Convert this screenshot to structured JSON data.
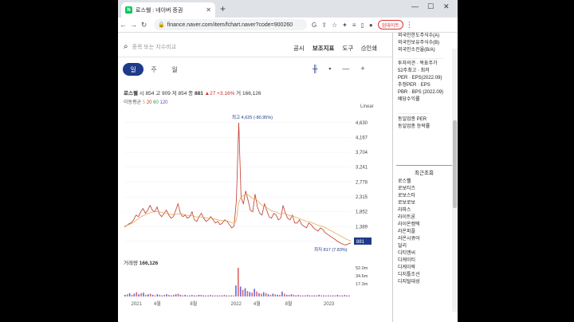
{
  "browser": {
    "tab_title": "로스웰 : 네이버 증권",
    "favicon": "N",
    "new_tab": "+",
    "url": "finance.naver.com/item/fchart.naver?code=900260",
    "update_label": "업데이트"
  },
  "toolbar": {
    "search_placeholder": "종목 또는 지수비교",
    "notice": "공시",
    "indicators": "보조지표",
    "tools": "도구",
    "print": "인쇄"
  },
  "range_tabs": [
    "일",
    "주",
    "월"
  ],
  "price": {
    "name": "로스웰",
    "open_label": "시",
    "open": "854",
    "high_label": "고",
    "high": "909",
    "low_label": "저",
    "low": "854",
    "close_label": "종",
    "close": "881",
    "change": "▲27",
    "pct": "+3.16%",
    "vol_label": "거",
    "volume": "166,126"
  },
  "ma": {
    "label": "이동평균",
    "p5": "5",
    "p20": "20",
    "p60": "60",
    "p120": "120"
  },
  "scale_label": "Linear",
  "price_labels": {
    "max": "최고 4,625 (-80.95%)",
    "min": "최저 817 (7.83%)",
    "last": "881"
  },
  "volume_panel": {
    "label": "거래량",
    "value": "166,126"
  },
  "chart_data": {
    "type": "line",
    "title": "",
    "xlabel": "",
    "ylabel": "",
    "y_ticks": [
      "4,630",
      "4,167",
      "3,704",
      "3,241",
      "2,778",
      "2,315",
      "1,852",
      "1,389",
      "926"
    ],
    "x_ticks": [
      "2021",
      "4월",
      "8월",
      "2022",
      "4월",
      "8월",
      "2023"
    ],
    "ylim": [
      800,
      4700
    ],
    "vol_ticks": [
      "52.0m",
      "34.6m",
      "17.3m"
    ],
    "series": [
      {
        "values": [
          1380,
          1420,
          1480,
          1510,
          1600,
          1750,
          1700,
          1850,
          1950,
          1800,
          1900,
          2050,
          1900,
          1850,
          2000,
          1780,
          1700,
          1800,
          1900,
          1750,
          1650,
          1700,
          1900,
          2100,
          1800,
          1700,
          1750,
          1650,
          1700,
          1850,
          1600,
          1550,
          1700,
          1800,
          1650,
          1550,
          1600,
          1700,
          1600,
          1500,
          1550,
          1450,
          1500,
          1600,
          1550,
          1450,
          1350,
          1400,
          2200,
          4625,
          2300,
          2100,
          2500,
          2200,
          1900,
          1850,
          2400,
          2000,
          1800,
          1750,
          2100,
          1900,
          1700,
          1650,
          1800,
          1750,
          1600,
          1650,
          2050,
          1800,
          1650,
          1600,
          1750,
          1500,
          1500,
          1600,
          1450,
          1400,
          1350,
          1500,
          1450,
          1350,
          1300,
          1250,
          1350,
          1300,
          1200,
          1150,
          1100,
          1050,
          1000,
          950,
          900,
          860,
          830,
          817,
          850,
          881
        ]
      },
      {
        "values": [
          1400,
          1420,
          1450,
          1480,
          1520,
          1580,
          1640,
          1690,
          1730,
          1760,
          1790,
          1820,
          1840,
          1850,
          1860,
          1850,
          1830,
          1810,
          1800,
          1790,
          1770,
          1760,
          1770,
          1790,
          1790,
          1780,
          1760,
          1740,
          1730,
          1730,
          1710,
          1690,
          1690,
          1690,
          1680,
          1660,
          1650,
          1650,
          1640,
          1620,
          1600,
          1580,
          1570,
          1570,
          1560,
          1540,
          1510,
          1490,
          1580,
          2150,
          2300,
          2350,
          2400,
          2380,
          2320,
          2260,
          2250,
          2200,
          2120,
          2050,
          2020,
          1980,
          1930,
          1880,
          1860,
          1840,
          1800,
          1780,
          1800,
          1790,
          1760,
          1730,
          1720,
          1690,
          1660,
          1640,
          1610,
          1580,
          1550,
          1540,
          1520,
          1490,
          1460,
          1430,
          1410,
          1390,
          1360,
          1320,
          1280,
          1240,
          1200,
          1160,
          1120,
          1080,
          1040,
          1000,
          970,
          950
        ]
      }
    ],
    "volume": [
      3,
      4,
      6,
      3,
      5,
      8,
      4,
      6,
      7,
      3,
      4,
      5,
      3,
      2,
      4,
      3,
      2,
      3,
      4,
      3,
      2,
      3,
      4,
      5,
      3,
      2,
      3,
      2,
      2,
      3,
      2,
      2,
      3,
      3,
      2,
      2,
      2,
      3,
      2,
      2,
      2,
      2,
      2,
      3,
      2,
      2,
      2,
      2,
      20,
      52,
      18,
      12,
      15,
      10,
      8,
      7,
      14,
      9,
      6,
      5,
      8,
      6,
      4,
      3,
      5,
      4,
      3,
      3,
      9,
      5,
      3,
      3,
      4,
      3,
      2,
      3,
      2,
      2,
      2,
      3,
      2,
      2,
      2,
      2,
      3,
      2,
      2,
      2,
      2,
      2,
      2,
      2,
      3,
      2,
      2,
      3,
      2,
      2
    ]
  },
  "sidebar": {
    "top_items": [
      "외국인한도주식수(A)",
      "외국인보유주식수(B)",
      "외국인소진율(B/A)"
    ],
    "mid_items": [
      "투자의견 · 목표주가",
      "52주최고 · 최저",
      "PER · EPS(2022.09)",
      "추정PER · EPS",
      "PBR · BPS (2022.09)",
      "배당수익률"
    ],
    "sector_items": [
      "동일업종 PER",
      "동일업종 등락률"
    ],
    "recent_label": "최근조회",
    "recent_items": [
      "로스웰",
      "로보티즈",
      "로보스타",
      "로보로보",
      "라파스",
      "라이트론",
      "라이온켐텍",
      "라온피플",
      "라온시큐어",
      "딜리",
      "디티앤씨",
      "디케이티",
      "디케이락",
      "디지틀조선",
      "디지털대성"
    ]
  },
  "colors": {
    "up": "#d62828",
    "down": "#1d5fd1",
    "accent": "#1e3a8a",
    "brand": "#03c75a"
  }
}
